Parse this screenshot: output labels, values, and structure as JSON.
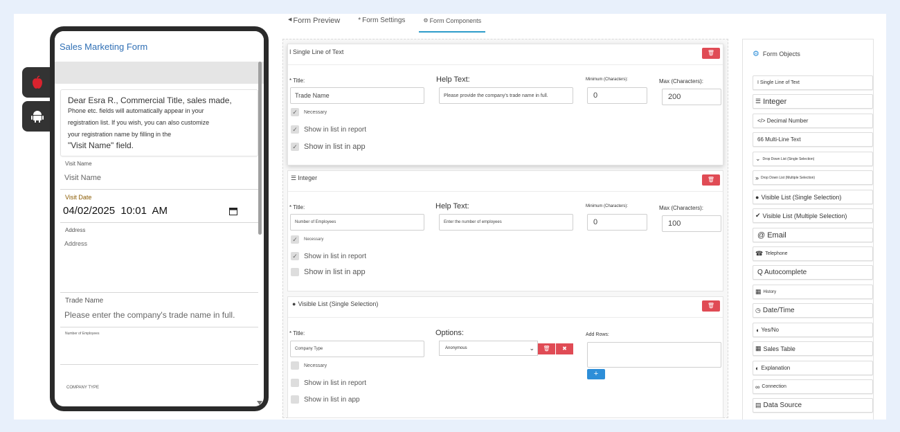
{
  "phone": {
    "title": "Sales Marketing Form",
    "note": {
      "line1": "Dear Esra R., Commercial Title, sales made,",
      "line2": "Phone etc. fields will automatically appear in your",
      "line3": "registration list. If you wish, you can also customize",
      "line4": "your registration name by filling in the",
      "line5": "\"Visit Name\" field."
    },
    "fields": [
      {
        "label": "Visit Name",
        "value": "Visit Name"
      },
      {
        "label": "Visit Date",
        "value": "04/02/2025  10:01  AM"
      },
      {
        "label": "Address",
        "value": "Address"
      },
      {
        "label": "Trade Name",
        "value": "Please enter the company's trade name in full."
      },
      {
        "label": "Number of Employees",
        "value": ""
      },
      {
        "label": "COMPANY TYPE",
        "value": ""
      }
    ]
  },
  "tabs": [
    "Form Preview",
    "Form Settings",
    "Form Components"
  ],
  "components": [
    {
      "header": "I Single Line of Text",
      "title_label": "* Title:",
      "title_value": "Trade Name",
      "help_label": "Help Text:",
      "help_value": "Please provide the company's trade name in full.",
      "min_label": "Minimum (Characters):",
      "min_value": "0",
      "max_label": "Max (Characters):",
      "max_value": "200",
      "necessary": "Necessary",
      "show_report": "Show in list in report",
      "show_app": "Show in list in app"
    },
    {
      "header": "Integer",
      "title_label": "* Title:",
      "title_value": "Number of Employees",
      "help_label": "Help Text:",
      "help_value": "Enter the number of employees",
      "min_label": "Minimum (Characters):",
      "min_value": "0",
      "max_label": "Max (Characters):",
      "max_value": "100",
      "necessary": "Necessary",
      "show_report": "Show in list in report",
      "show_app": "Show in list in app"
    },
    {
      "header": "Visible List (Single Selection)",
      "title_label": "* Title:",
      "title_value": "Company Type",
      "options_label": "Options:",
      "options_value": "Anonymous",
      "add_rows_label": "Add Rows:",
      "necessary": "Necessary",
      "show_report": "Show in list in report",
      "show_app": "Show in list in app"
    }
  ],
  "objects": {
    "title": "Form Objects",
    "items": [
      {
        "icon": "text-cursor-icon",
        "glyph": "",
        "label": "I Single Line of Text"
      },
      {
        "icon": "list-number-icon",
        "glyph": "☰",
        "label": "Integer"
      },
      {
        "icon": "code-icon",
        "glyph": "",
        "label": "</> Decimal Number"
      },
      {
        "icon": "quote-icon",
        "glyph": "",
        "label": "66 Multi-Line Text"
      },
      {
        "icon": "chevron-down-icon",
        "glyph": "⌄",
        "label": "Drop Down List (Single Selection)"
      },
      {
        "icon": "double-chevron-icon",
        "glyph": "»",
        "label": "Drop Down List (Multiple Selection)"
      },
      {
        "icon": "circle-icon",
        "glyph": "●",
        "label": "Visible List (Single Selection)"
      },
      {
        "icon": "check-icon",
        "glyph": "✔",
        "label": "Visible List (Multiple Selection)"
      },
      {
        "icon": "at-icon",
        "glyph": "",
        "label": "@ Email"
      },
      {
        "icon": "phone-icon",
        "glyph": "☎",
        "label": "Telephone"
      },
      {
        "icon": "search-icon",
        "glyph": "",
        "label": "Q Autocomplete"
      },
      {
        "icon": "calendar-icon",
        "glyph": "▦",
        "label": "History"
      },
      {
        "icon": "clock-icon",
        "glyph": "◷",
        "label": "Date/Time"
      },
      {
        "icon": "toggle-icon",
        "glyph": "◖",
        "label": "Yes/No"
      },
      {
        "icon": "table-icon",
        "glyph": "▦",
        "label": "Sales Table"
      },
      {
        "icon": "contrast-icon",
        "glyph": "◐",
        "label": "Explanation"
      },
      {
        "icon": "link-icon",
        "glyph": "∞",
        "label": "Connection"
      },
      {
        "icon": "database-icon",
        "glyph": "▤",
        "label": "Data Source"
      }
    ]
  },
  "colors": {
    "accent": "#2d9bc9",
    "danger": "#e04b55",
    "primary": "#2d8ed8",
    "title_blue": "#2f6fb5",
    "apple_red": "#d9232e"
  }
}
